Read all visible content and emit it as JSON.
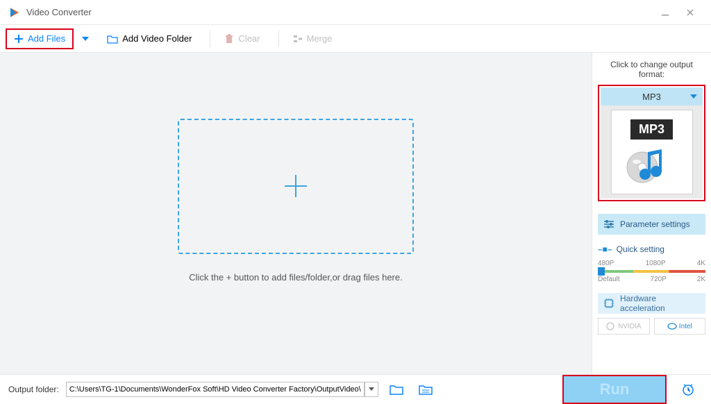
{
  "title": "Video Converter",
  "toolbar": {
    "add_files": "Add Files",
    "add_folder": "Add Video Folder",
    "clear": "Clear",
    "merge": "Merge"
  },
  "dropzone": {
    "hint": "Click the + button to add files/folder,or drag files here."
  },
  "sidebar": {
    "change_label": "Click to change output format:",
    "format_name": "MP3",
    "format_badge": "MP3",
    "param_settings": "Parameter settings",
    "quick_setting": "Quick setting",
    "scale_top": [
      "480P",
      "1080P",
      "4K"
    ],
    "scale_bottom": [
      "Default",
      "720P",
      "2K"
    ],
    "hw_accel": "Hardware acceleration",
    "nvidia": "NVIDIA",
    "intel": "Intel"
  },
  "footer": {
    "label": "Output folder:",
    "path": "C:\\Users\\TG-1\\Documents\\WonderFox Soft\\HD Video Converter Factory\\OutputVideo\\",
    "run": "Run"
  }
}
